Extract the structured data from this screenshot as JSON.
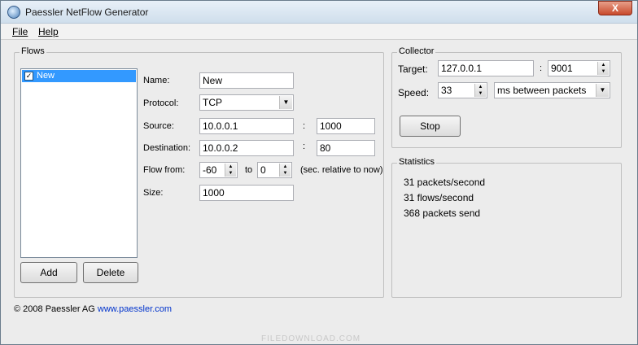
{
  "window": {
    "title": "Paessler NetFlow Generator",
    "close_label": "X"
  },
  "menu": {
    "file": "File",
    "help": "Help"
  },
  "flows": {
    "legend": "Flows",
    "list_items": [
      {
        "label": "New",
        "checked": true
      }
    ],
    "add_label": "Add",
    "delete_label": "Delete",
    "name_label": "Name:",
    "name_value": "New",
    "protocol_label": "Protocol:",
    "protocol_value": "TCP",
    "source_label": "Source:",
    "source_ip": "10.0.0.1",
    "source_port": "1000",
    "destination_label": "Destination:",
    "destination_ip": "10.0.0.2",
    "destination_port": "80",
    "colon": ":",
    "flow_from_label": "Flow from:",
    "flow_from_value": "-60",
    "to_label": "to",
    "flow_to_value": "0",
    "relative_note": "(sec. relative to now)",
    "size_label": "Size:",
    "size_value": "1000"
  },
  "collector": {
    "legend": "Collector",
    "target_label": "Target:",
    "target_ip": "127.0.0.1",
    "target_port": "9001",
    "speed_label": "Speed:",
    "speed_value": "33",
    "speed_unit": "ms between packets",
    "stop_label": "Stop"
  },
  "statistics": {
    "legend": "Statistics",
    "line1": "31 packets/second",
    "line2": "31 flows/second",
    "line3": "368 packets send"
  },
  "footer": {
    "copyright": "© 2008 Paessler AG",
    "link": "www.paessler.com"
  },
  "watermark": "FILEDOWNLOAD.COM"
}
